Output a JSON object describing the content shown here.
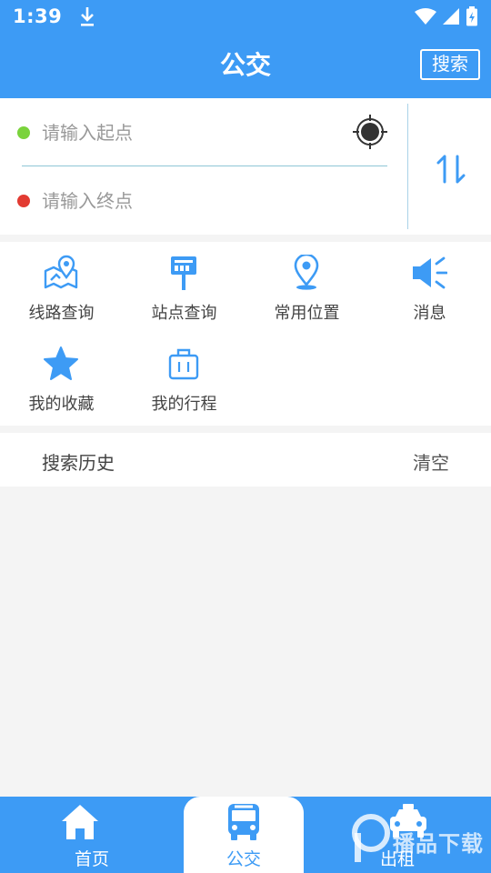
{
  "status_bar": {
    "time": "1:39",
    "icons": [
      "download-icon",
      "wifi-icon",
      "signal-icon",
      "battery-charging-icon"
    ]
  },
  "app_bar": {
    "title": "公交",
    "search_label": "搜索"
  },
  "route": {
    "start_placeholder": "请输入起点",
    "end_placeholder": "请输入终点",
    "start_value": "",
    "end_value": "",
    "start_dot_color": "#7ad33c",
    "end_dot_color": "#e23b32"
  },
  "shortcuts": [
    {
      "label": "线路查询",
      "icon": "route-map-icon"
    },
    {
      "label": "站点查询",
      "icon": "bus-stop-sign-icon"
    },
    {
      "label": "常用位置",
      "icon": "location-pin-icon"
    },
    {
      "label": "消息",
      "icon": "speaker-icon"
    },
    {
      "label": "我的收藏",
      "icon": "star-icon"
    },
    {
      "label": "我的行程",
      "icon": "suitcase-icon"
    }
  ],
  "history": {
    "title": "搜索历史",
    "clear_label": "清空"
  },
  "tabs": [
    {
      "label": "首页",
      "icon": "home-icon",
      "active": false
    },
    {
      "label": "公交",
      "icon": "bus-icon",
      "active": true
    },
    {
      "label": "出租",
      "icon": "taxi-icon",
      "active": false
    }
  ],
  "watermark": {
    "text": "播品下载"
  },
  "colors": {
    "primary": "#3d9bf5",
    "background": "#f4f4f4"
  }
}
